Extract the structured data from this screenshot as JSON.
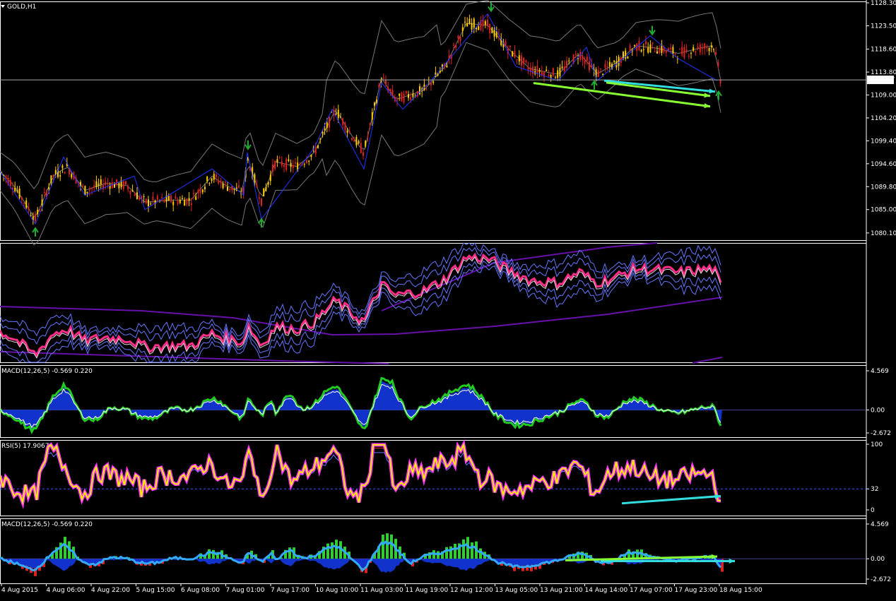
{
  "window": {
    "symbol_label": "GOLD,H1"
  },
  "chart_data": [
    {
      "name": "price",
      "type": "candlestick",
      "title": "GOLD,H1",
      "ylim": [
        1078.6,
        1128.6
      ],
      "y_ticks": [
        "1128.30",
        "1123.50",
        "1118.60",
        "1113.80",
        "1109.00",
        "1104.20",
        "1099.40",
        "1094.60",
        "1089.80",
        "1085.00",
        "1080.10"
      ],
      "y_tick_values": [
        1128.3,
        1123.5,
        1118.6,
        1113.8,
        1109.0,
        1104.2,
        1099.4,
        1094.6,
        1089.8,
        1085.0,
        1080.1
      ],
      "current_price": "1112.17",
      "current_price_value": 1112.17,
      "zigzag": [
        [
          0,
          1093
        ],
        [
          50,
          1082
        ],
        [
          90,
          1096
        ],
        [
          120,
          1088
        ],
        [
          190,
          1092
        ],
        [
          205,
          1085
        ],
        [
          300,
          1093.5
        ],
        [
          345,
          1088
        ],
        [
          350,
          1097
        ],
        [
          370,
          1083
        ],
        [
          445,
          1098
        ],
        [
          470,
          1106
        ],
        [
          515,
          1093.5
        ],
        [
          540,
          1111.6
        ],
        [
          570,
          1106
        ],
        [
          610,
          1112
        ],
        [
          690,
          1126
        ],
        [
          730,
          1115
        ],
        [
          790,
          1112
        ],
        [
          830,
          1119
        ],
        [
          845,
          1112
        ],
        [
          920,
          1121.4
        ],
        [
          960,
          1116.6
        ],
        [
          1015,
          1112
        ]
      ],
      "close_path": [
        [
          0,
          1093
        ],
        [
          20,
          1090
        ],
        [
          50,
          1083
        ],
        [
          75,
          1092
        ],
        [
          95,
          1094
        ],
        [
          120,
          1089
        ],
        [
          150,
          1090.5
        ],
        [
          180,
          1090
        ],
        [
          205,
          1086.5
        ],
        [
          240,
          1087
        ],
        [
          270,
          1087
        ],
        [
          300,
          1092
        ],
        [
          320,
          1090
        ],
        [
          345,
          1088.5
        ],
        [
          350,
          1096
        ],
        [
          370,
          1087
        ],
        [
          390,
          1095
        ],
        [
          420,
          1094
        ],
        [
          445,
          1097
        ],
        [
          475,
          1106
        ],
        [
          500,
          1100
        ],
        [
          515,
          1097
        ],
        [
          540,
          1112.6
        ],
        [
          560,
          1108
        ],
        [
          600,
          1110
        ],
        [
          630,
          1115
        ],
        [
          660,
          1124
        ],
        [
          690,
          1123.6
        ],
        [
          720,
          1118.6
        ],
        [
          750,
          1114.5
        ],
        [
          790,
          1113.3
        ],
        [
          820,
          1117.8
        ],
        [
          845,
          1113.4
        ],
        [
          870,
          1115.5
        ],
        [
          900,
          1119.3
        ],
        [
          930,
          1118.8
        ],
        [
          960,
          1117.7
        ],
        [
          990,
          1118.8
        ],
        [
          1010,
          1119.4
        ],
        [
          1020,
          1112
        ]
      ],
      "arrows_down": [
        [
          695,
          1126.3
        ],
        [
          923,
          1121.4
        ],
        [
          351,
          1097.4
        ]
      ],
      "arrows_up": [
        [
          50,
          1081.4
        ],
        [
          370,
          1083.3
        ],
        [
          841,
          1112.2
        ],
        [
          1017,
          1110
        ]
      ],
      "trendlines": [
        {
          "color": "#33dddd",
          "from": [
            855,
            1112
          ],
          "to": [
            1012,
            1109.7
          ]
        },
        {
          "color": "#88ff33",
          "from": [
            858,
            1111.6
          ],
          "to": [
            1005,
            1108.8
          ]
        },
        {
          "color": "#88ff33",
          "from": [
            755,
            1111.5
          ],
          "to": [
            1005,
            1106.6
          ]
        }
      ]
    },
    {
      "name": "indicator-2",
      "type": "line",
      "ylim": [
        0,
        100
      ]
    },
    {
      "name": "macd-1",
      "type": "bar+line",
      "title": "MACD(12,26,5) -0.569 0.220",
      "y_ticks": [
        "4.569",
        "0.00",
        "-2.672"
      ],
      "y_tick_values": [
        4.569,
        0,
        -2.672
      ]
    },
    {
      "name": "rsi",
      "type": "line",
      "title": "RSI(5) 17.9067",
      "y_ticks": [
        "100",
        "32",
        "0"
      ],
      "y_tick_values": [
        100,
        32,
        0
      ],
      "trendlines": [
        {
          "color": "#33dddd",
          "from": [
            880,
            10
          ],
          "to": [
            1020,
            21
          ]
        }
      ]
    },
    {
      "name": "macd-2",
      "type": "histogram+line",
      "title": "MACD(12,26,5) -0.569 0.220",
      "y_ticks": [
        "4.569",
        "0.00",
        "-2.672"
      ],
      "y_tick_values": [
        4.569,
        0,
        -2.672
      ],
      "trendlines": [
        {
          "color": "#33dddd",
          "from": [
            850,
            -0.3
          ],
          "to": [
            1040,
            -0.3
          ]
        },
        {
          "color": "#88ff33",
          "from": [
            800,
            -0.2
          ],
          "to": [
            1015,
            0.3
          ]
        }
      ]
    }
  ],
  "x_axis": {
    "labels": [
      "4 Aug 2015",
      "4 Aug 06:00",
      "4 Aug 22:00",
      "5 Aug 15:00",
      "6 Aug 08:00",
      "7 Aug 01:00",
      "7 Aug 17:00",
      "10 Aug 10:00",
      "11 Aug 03:00",
      "11 Aug 19:00",
      "12 Aug 12:00",
      "13 Aug 05:00",
      "13 Aug 21:00",
      "14 Aug 14:00",
      "17 Aug 07:00",
      "17 Aug 23:00",
      "18 Aug 15:00"
    ]
  },
  "colors": {
    "up": "#ffcc00",
    "down": "#dd2222",
    "grid": "#ffffff",
    "bands": "#777777",
    "zigzag": "#2233ff",
    "pink": "#ff2d8a",
    "green": "#22cc22",
    "blue_fill": "#1133cc",
    "yellow": "#ffee00",
    "magenta": "#ff33ff"
  }
}
